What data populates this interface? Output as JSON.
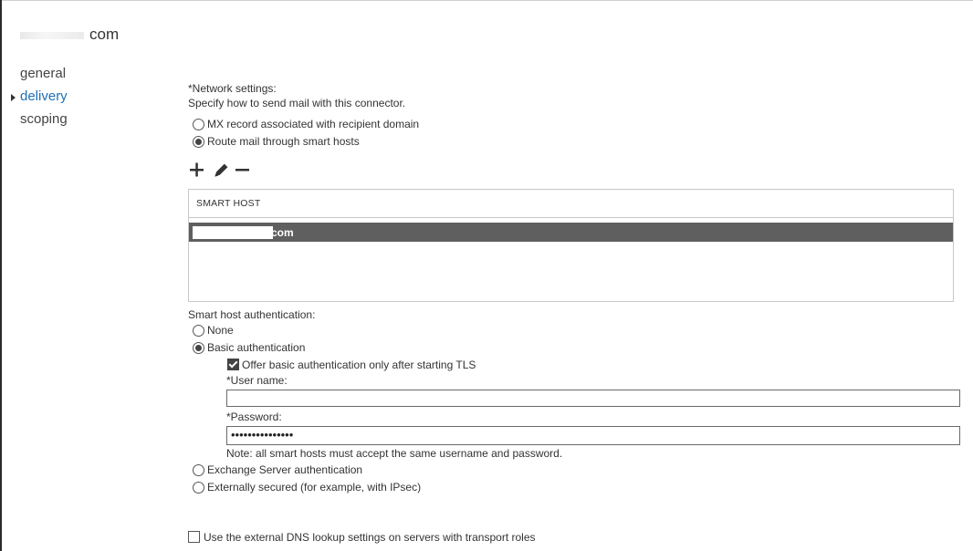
{
  "header": {
    "title": "com"
  },
  "nav": {
    "items": [
      "general",
      "delivery",
      "scoping"
    ],
    "active": "delivery"
  },
  "network": {
    "label": "*Network settings:",
    "hint": "Specify how to send mail with this connector.",
    "options": [
      "MX record associated with recipient domain",
      "Route mail through smart hosts"
    ],
    "selected": "Route mail through smart hosts"
  },
  "toolbar": {
    "icons": [
      "add-icon",
      "edit-icon",
      "remove-icon"
    ]
  },
  "smart_hosts": {
    "column_header": "SMART HOST",
    "rows": [
      "com"
    ]
  },
  "auth": {
    "label": "Smart host authentication:",
    "none": "None",
    "basic": "Basic authentication",
    "tls_checkbox": "Offer basic authentication only after starting TLS",
    "username_label": "*User name:",
    "username_value": "",
    "password_label": "*Password:",
    "password_value": "•••••••••••••••",
    "note": "Note: all smart hosts must accept the same username and password.",
    "exchange": "Exchange Server authentication",
    "external": "Externally secured (for example, with IPsec)",
    "selected": "Basic authentication"
  },
  "dns": {
    "label": "Use the external DNS lookup settings on servers with transport roles"
  },
  "colors": {
    "accent": "#1e6fb7",
    "selected_row": "#5f5f5f"
  }
}
